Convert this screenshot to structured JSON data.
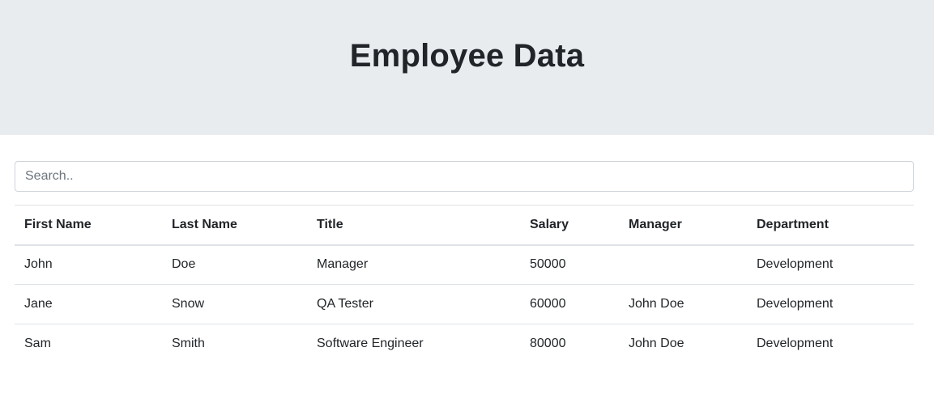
{
  "header": {
    "title": "Employee Data"
  },
  "search": {
    "placeholder": "Search..",
    "value": ""
  },
  "table": {
    "columns": [
      "First Name",
      "Last Name",
      "Title",
      "Salary",
      "Manager",
      "Department"
    ],
    "rows": [
      [
        "John",
        "Doe",
        "Manager",
        "50000",
        "",
        "Development"
      ],
      [
        "Jane",
        "Snow",
        "QA Tester",
        "60000",
        "John Doe",
        "Development"
      ],
      [
        "Sam",
        "Smith",
        "Software Engineer",
        "80000",
        "John Doe",
        "Development"
      ]
    ]
  },
  "colors": {
    "header_bg": "#e9ecef",
    "text": "#212529",
    "border": "#dee2e6"
  }
}
